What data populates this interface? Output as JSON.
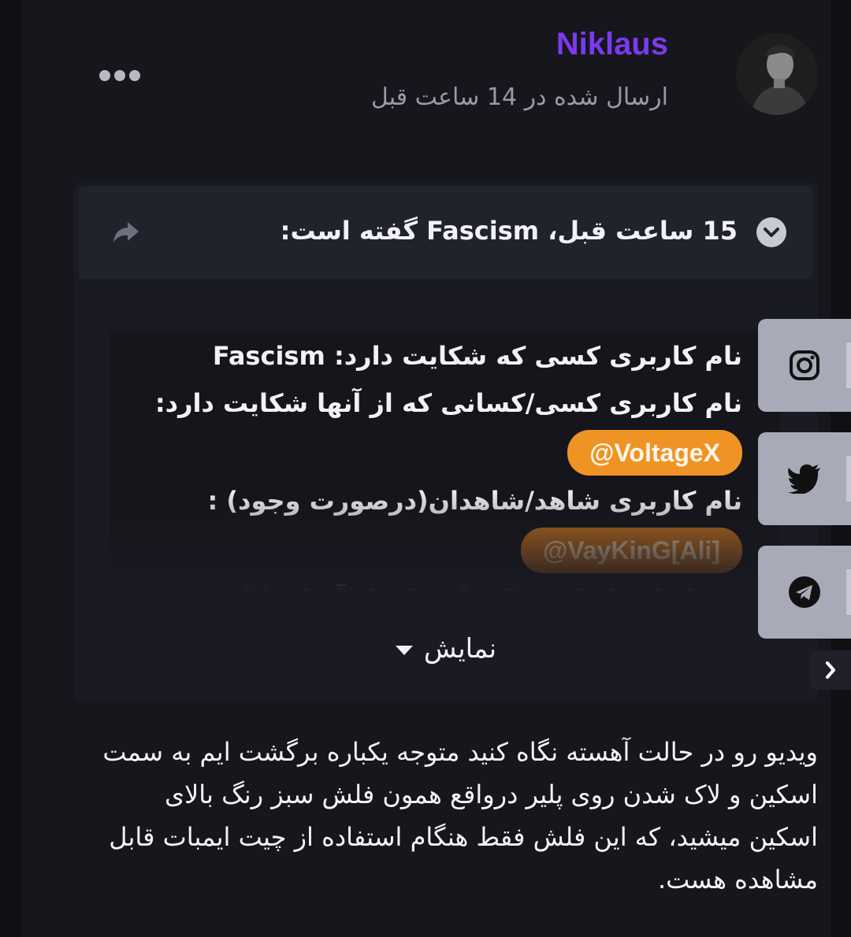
{
  "post": {
    "username": "Niklaus",
    "posted_time": "ارسال شده در 14 ساعت قبل",
    "more_icon": "ellipsis-icon"
  },
  "quote": {
    "title": "15 ساعت قبل، Fascism گفته است:",
    "items": [
      "نام کاربری کسی که شکایت دارد: Fascism",
      "نام کاربری کسی/کسانی که از آنها شکایت دارد:",
      "نام کاربری شاهد/شاهدان(درصورت وجود) :",
      "مقدار امتیاز کسی/کسانی که از آنها شکایت"
    ],
    "mention_1": "@VoltageX",
    "mention_2": "@VayKinG[Ali]",
    "show_more": "نمایش"
  },
  "body_text": "ویدیو رو در حالت آهسته نگاه کنید متوجه یکباره برگشت ایم به سمت اسکین و لاک شدن روی پلیر درواقع همون فلش سبز رنگ بالای اسکین میشید، که این فلش فقط هنگام استفاده از چیت ایمبات قابل مشاهده هست.",
  "colors": {
    "username": "#7c3aed",
    "mention": "#f09325",
    "background": "#0f0f14"
  },
  "social": [
    "instagram-icon",
    "twitter-icon",
    "telegram-icon"
  ]
}
